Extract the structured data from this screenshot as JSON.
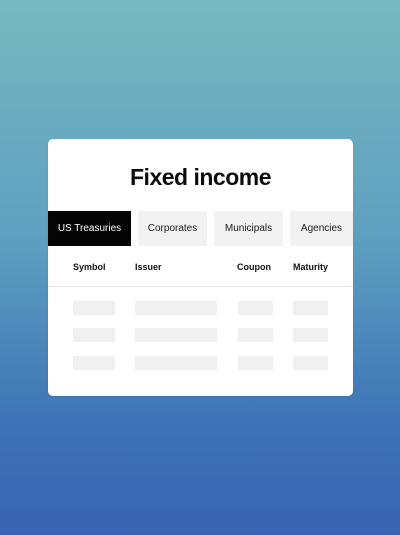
{
  "card": {
    "title": "Fixed income"
  },
  "tabs": [
    {
      "label": "US Treasuries",
      "active": true
    },
    {
      "label": "Corporates",
      "active": false
    },
    {
      "label": "Municipals",
      "active": false
    },
    {
      "label": "Agencies",
      "active": false
    }
  ],
  "table": {
    "columns": [
      "Symbol",
      "Issuer",
      "Coupon",
      "Maturity"
    ],
    "rows": [
      {
        "symbol": "",
        "issuer": "",
        "coupon": "",
        "maturity": ""
      },
      {
        "symbol": "",
        "issuer": "",
        "coupon": "",
        "maturity": ""
      },
      {
        "symbol": "",
        "issuer": "",
        "coupon": "",
        "maturity": ""
      }
    ]
  },
  "colors": {
    "background_top": "#79b8bf",
    "background_bottom": "#3863b2",
    "active_tab": "#050505",
    "inactive_tab": "#f2f2f2",
    "placeholder": "#f0f0f0"
  }
}
